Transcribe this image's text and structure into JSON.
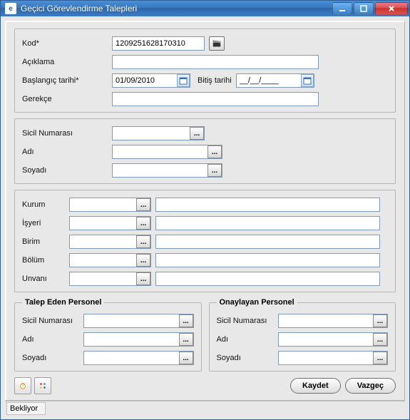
{
  "window": {
    "title": "Geçici Görevlendirme Talepleri"
  },
  "general": {
    "kod_label": "Kod*",
    "kod_value": "1209251628170310",
    "aciklama_label": "Açıklama",
    "aciklama_value": "",
    "baslangic_label": "Başlangıç tarihi*",
    "baslangic_value": "01/09/2010",
    "bitis_label": "Bitiş tarihi",
    "bitis_value": "__/__/____",
    "gerekce_label": "Gerekçe",
    "gerekce_value": ""
  },
  "personel": {
    "sicil_label": "Sicil Numarası",
    "sicil_value": "",
    "adi_label": "Adı",
    "adi_value": "",
    "soyadi_label": "Soyadı",
    "soyadi_value": ""
  },
  "org": {
    "kurum_label": "Kurum",
    "kurum_code": "",
    "kurum_value": "",
    "isyeri_label": "İşyeri",
    "isyeri_code": "",
    "isyeri_value": "",
    "birim_label": "Birim",
    "birim_code": "",
    "birim_value": "",
    "bolum_label": "Bölüm",
    "bolum_code": "",
    "bolum_value": "",
    "unvani_label": "Unvanı",
    "unvani_code": "",
    "unvani_value": ""
  },
  "talep_eden": {
    "legend": "Talep Eden Personel",
    "sicil_label": "Sicil Numarası",
    "sicil_value": "",
    "adi_label": "Adı",
    "adi_value": "",
    "soyadi_label": "Soyadı",
    "soyadi_value": ""
  },
  "onaylayan": {
    "legend": "Onaylayan Personel",
    "sicil_label": "Sicil Numarası",
    "sicil_value": "",
    "adi_label": "Adı",
    "adi_value": "",
    "soyadi_label": "Soyadı",
    "soyadi_value": ""
  },
  "buttons": {
    "kaydet": "Kaydet",
    "vazgec": "Vazgeç"
  },
  "status": {
    "text": "Bekliyor"
  },
  "icons": {
    "generate": "generate-icon",
    "calendar": "calendar-icon",
    "lookup": "...",
    "timer": "timer-icon",
    "nodes": "nodes-icon"
  }
}
